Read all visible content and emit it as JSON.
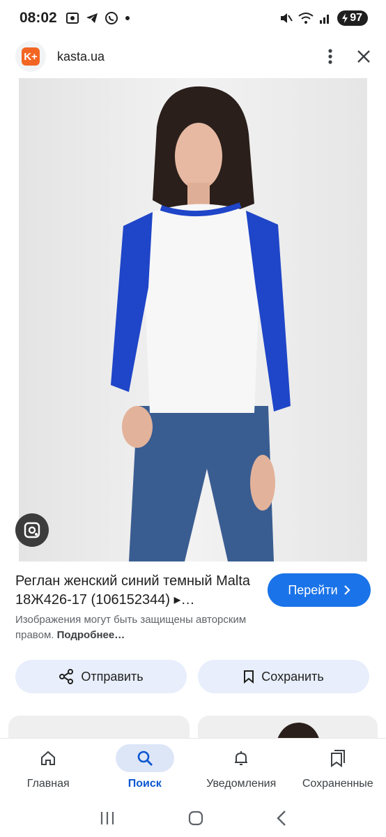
{
  "status_bar": {
    "time": "08:02",
    "battery": "97",
    "left_icons": [
      "screenshot-icon",
      "telegram-icon",
      "viber-icon",
      "dot-icon"
    ],
    "right_icons": [
      "mute-icon",
      "wifi-icon",
      "signal-icon",
      "battery-icon"
    ]
  },
  "top_bar": {
    "logo_text": "K+",
    "domain": "kasta.ua"
  },
  "image": {
    "alt_subject": "product-photo"
  },
  "result": {
    "title": "Реглан женский синий темный Malta 18Ж426-17 (106152344) ▸…",
    "go_button": "Перейти",
    "copyright_text": "Изображения могут быть защищены авторским правом.",
    "copyright_link": "Подробнее…"
  },
  "actions": {
    "share": "Отправить",
    "save": "Сохранить"
  },
  "bottom_nav": {
    "items": [
      {
        "label": "Главная",
        "icon": "home-icon"
      },
      {
        "label": "Поиск",
        "icon": "search-icon",
        "active": true
      },
      {
        "label": "Уведомления",
        "icon": "bell-icon"
      },
      {
        "label": "Сохраненные",
        "icon": "bookmarks-icon"
      }
    ]
  },
  "colors": {
    "accent": "#1a73e8",
    "active_nav": "#0b57d0",
    "pill_bg": "#e8eefb",
    "brand_logo": "#f26522",
    "sleeve_blue": "#1f45c8"
  }
}
